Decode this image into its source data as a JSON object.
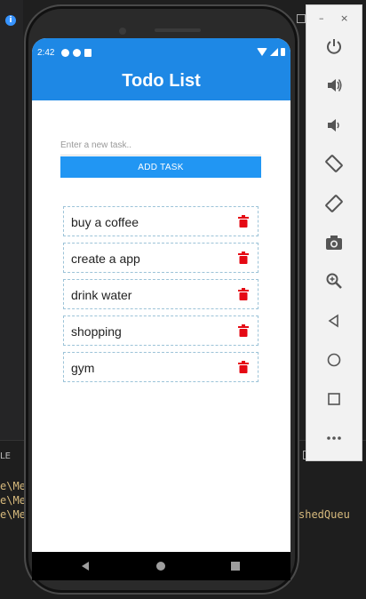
{
  "background": {
    "panel_title": "LE",
    "terminal_lines": [
      "e\\Me",
      "e\\Me",
      "e\\Me"
    ],
    "terminal_right_fragment": "shedQueu"
  },
  "phone": {
    "status_bar": {
      "time": "2:42"
    },
    "app": {
      "title": "Todo List",
      "task_input": {
        "placeholder": "Enter a new task..",
        "value": ""
      },
      "add_button_label": "ADD TASK",
      "todos": [
        {
          "text": "buy a coffee"
        },
        {
          "text": "create a app"
        },
        {
          "text": "drink water"
        },
        {
          "text": "shopping"
        },
        {
          "text": "gym"
        }
      ]
    },
    "colors": {
      "primary": "#1e88e5",
      "button": "#2196f3",
      "delete": "#e50914"
    }
  },
  "emulator_toolbar": {
    "window_buttons": [
      "–",
      "×"
    ],
    "buttons": [
      {
        "icon": "power-icon"
      },
      {
        "icon": "volume-up-icon"
      },
      {
        "icon": "volume-down-icon"
      },
      {
        "icon": "rotate-left-icon"
      },
      {
        "icon": "rotate-right-icon"
      },
      {
        "icon": "camera-icon"
      },
      {
        "icon": "zoom-icon"
      },
      {
        "icon": "back-icon"
      },
      {
        "icon": "home-icon"
      },
      {
        "icon": "overview-icon"
      },
      {
        "icon": "more-icon"
      }
    ]
  }
}
